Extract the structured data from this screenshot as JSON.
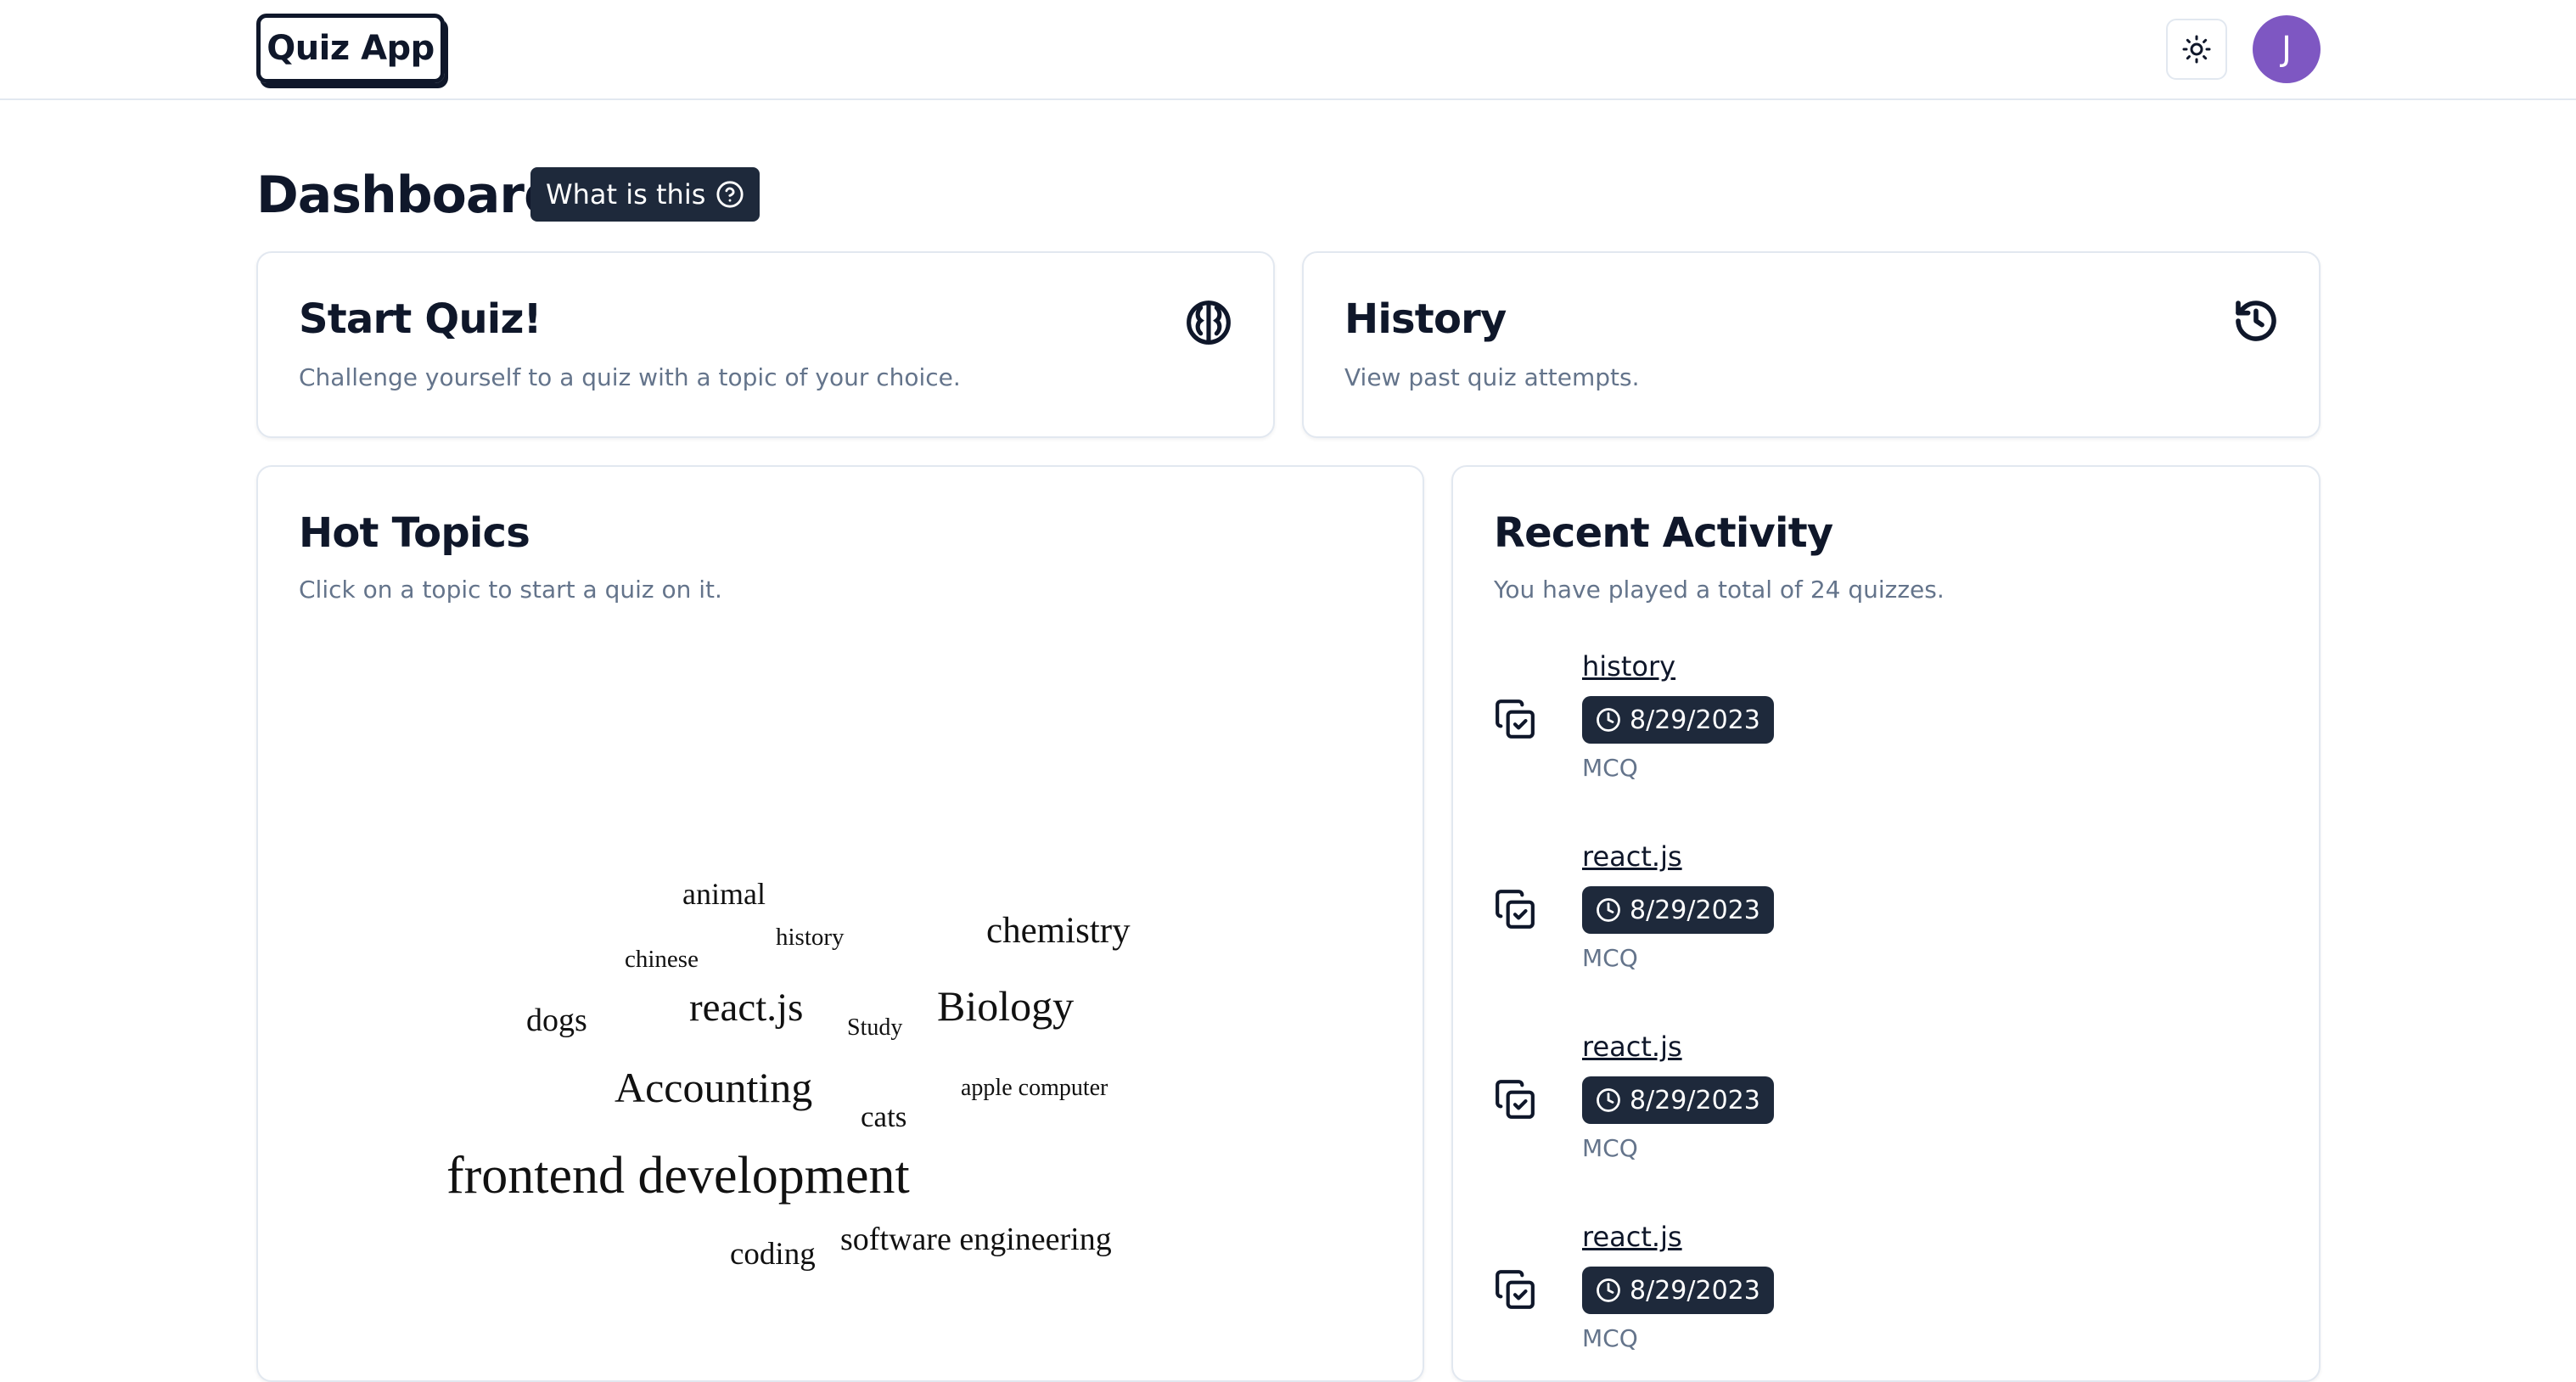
{
  "header": {
    "logo": "Quiz App",
    "theme_icon": "sun-icon",
    "avatar_initial": "J",
    "avatar_color": "#7e57c2"
  },
  "page": {
    "title": "Dashboard",
    "help_label": "What is this",
    "help_icon": "question-circle-icon"
  },
  "start_quiz": {
    "title": "Start Quiz!",
    "description": "Challenge yourself to a quiz with a topic of your choice.",
    "icon": "brain-icon"
  },
  "history": {
    "title": "History",
    "description": "View past quiz attempts.",
    "icon": "history-icon"
  },
  "hot_topics": {
    "title": "Hot Topics",
    "description": "Click on a topic to start a quiz on it.",
    "words": [
      {
        "text": "animal"
      },
      {
        "text": "history"
      },
      {
        "text": "chemistry"
      },
      {
        "text": "chinese"
      },
      {
        "text": "dogs"
      },
      {
        "text": "react.js"
      },
      {
        "text": "Study"
      },
      {
        "text": "Biology"
      },
      {
        "text": "Accounting"
      },
      {
        "text": "apple computer"
      },
      {
        "text": "cats"
      },
      {
        "text": "frontend development"
      },
      {
        "text": "coding"
      },
      {
        "text": "software engineering"
      }
    ]
  },
  "recent_activity": {
    "title": "Recent Activity",
    "description": "You have played a total of 24 quizzes.",
    "items": [
      {
        "topic": "history",
        "date": "8/29/2023",
        "type": "MCQ"
      },
      {
        "topic": "react.js",
        "date": "8/29/2023",
        "type": "MCQ"
      },
      {
        "topic": "react.js",
        "date": "8/29/2023",
        "type": "MCQ"
      },
      {
        "topic": "react.js",
        "date": "8/29/2023",
        "type": "MCQ"
      }
    ]
  },
  "colors": {
    "primary": "#0f172a",
    "badge_bg": "#1e293b",
    "muted_text": "#64748b",
    "border": "#e2e8f0"
  }
}
